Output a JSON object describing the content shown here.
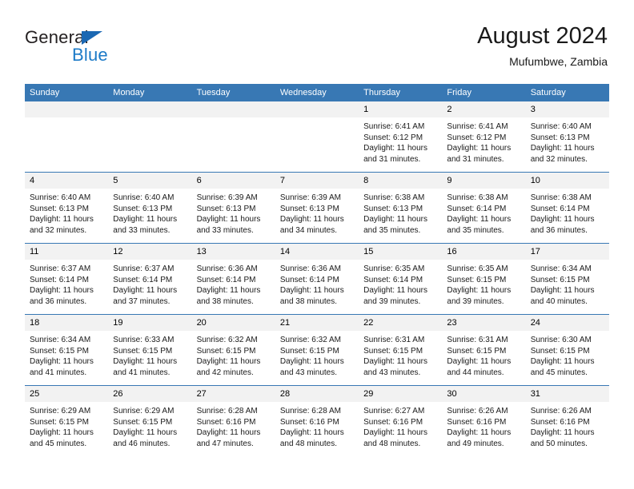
{
  "brand": {
    "name_part1": "General",
    "name_part2": "Blue",
    "accent_color": "#1c7ac7",
    "triangle_color": "#1b68b3"
  },
  "header": {
    "title": "August 2024",
    "subtitle": "Mufumbwe, Zambia",
    "header_bg": "#3878b4",
    "daynum_bg": "#f2f2f2"
  },
  "weekdays": [
    "Sunday",
    "Monday",
    "Tuesday",
    "Wednesday",
    "Thursday",
    "Friday",
    "Saturday"
  ],
  "weeks": [
    [
      {
        "day": "",
        "sunrise": "",
        "sunset": "",
        "daylight_line1": "",
        "daylight_line2": ""
      },
      {
        "day": "",
        "sunrise": "",
        "sunset": "",
        "daylight_line1": "",
        "daylight_line2": ""
      },
      {
        "day": "",
        "sunrise": "",
        "sunset": "",
        "daylight_line1": "",
        "daylight_line2": ""
      },
      {
        "day": "",
        "sunrise": "",
        "sunset": "",
        "daylight_line1": "",
        "daylight_line2": ""
      },
      {
        "day": "1",
        "sunrise": "Sunrise: 6:41 AM",
        "sunset": "Sunset: 6:12 PM",
        "daylight_line1": "Daylight: 11 hours",
        "daylight_line2": "and 31 minutes."
      },
      {
        "day": "2",
        "sunrise": "Sunrise: 6:41 AM",
        "sunset": "Sunset: 6:12 PM",
        "daylight_line1": "Daylight: 11 hours",
        "daylight_line2": "and 31 minutes."
      },
      {
        "day": "3",
        "sunrise": "Sunrise: 6:40 AM",
        "sunset": "Sunset: 6:13 PM",
        "daylight_line1": "Daylight: 11 hours",
        "daylight_line2": "and 32 minutes."
      }
    ],
    [
      {
        "day": "4",
        "sunrise": "Sunrise: 6:40 AM",
        "sunset": "Sunset: 6:13 PM",
        "daylight_line1": "Daylight: 11 hours",
        "daylight_line2": "and 32 minutes."
      },
      {
        "day": "5",
        "sunrise": "Sunrise: 6:40 AM",
        "sunset": "Sunset: 6:13 PM",
        "daylight_line1": "Daylight: 11 hours",
        "daylight_line2": "and 33 minutes."
      },
      {
        "day": "6",
        "sunrise": "Sunrise: 6:39 AM",
        "sunset": "Sunset: 6:13 PM",
        "daylight_line1": "Daylight: 11 hours",
        "daylight_line2": "and 33 minutes."
      },
      {
        "day": "7",
        "sunrise": "Sunrise: 6:39 AM",
        "sunset": "Sunset: 6:13 PM",
        "daylight_line1": "Daylight: 11 hours",
        "daylight_line2": "and 34 minutes."
      },
      {
        "day": "8",
        "sunrise": "Sunrise: 6:38 AM",
        "sunset": "Sunset: 6:13 PM",
        "daylight_line1": "Daylight: 11 hours",
        "daylight_line2": "and 35 minutes."
      },
      {
        "day": "9",
        "sunrise": "Sunrise: 6:38 AM",
        "sunset": "Sunset: 6:14 PM",
        "daylight_line1": "Daylight: 11 hours",
        "daylight_line2": "and 35 minutes."
      },
      {
        "day": "10",
        "sunrise": "Sunrise: 6:38 AM",
        "sunset": "Sunset: 6:14 PM",
        "daylight_line1": "Daylight: 11 hours",
        "daylight_line2": "and 36 minutes."
      }
    ],
    [
      {
        "day": "11",
        "sunrise": "Sunrise: 6:37 AM",
        "sunset": "Sunset: 6:14 PM",
        "daylight_line1": "Daylight: 11 hours",
        "daylight_line2": "and 36 minutes."
      },
      {
        "day": "12",
        "sunrise": "Sunrise: 6:37 AM",
        "sunset": "Sunset: 6:14 PM",
        "daylight_line1": "Daylight: 11 hours",
        "daylight_line2": "and 37 minutes."
      },
      {
        "day": "13",
        "sunrise": "Sunrise: 6:36 AM",
        "sunset": "Sunset: 6:14 PM",
        "daylight_line1": "Daylight: 11 hours",
        "daylight_line2": "and 38 minutes."
      },
      {
        "day": "14",
        "sunrise": "Sunrise: 6:36 AM",
        "sunset": "Sunset: 6:14 PM",
        "daylight_line1": "Daylight: 11 hours",
        "daylight_line2": "and 38 minutes."
      },
      {
        "day": "15",
        "sunrise": "Sunrise: 6:35 AM",
        "sunset": "Sunset: 6:14 PM",
        "daylight_line1": "Daylight: 11 hours",
        "daylight_line2": "and 39 minutes."
      },
      {
        "day": "16",
        "sunrise": "Sunrise: 6:35 AM",
        "sunset": "Sunset: 6:15 PM",
        "daylight_line1": "Daylight: 11 hours",
        "daylight_line2": "and 39 minutes."
      },
      {
        "day": "17",
        "sunrise": "Sunrise: 6:34 AM",
        "sunset": "Sunset: 6:15 PM",
        "daylight_line1": "Daylight: 11 hours",
        "daylight_line2": "and 40 minutes."
      }
    ],
    [
      {
        "day": "18",
        "sunrise": "Sunrise: 6:34 AM",
        "sunset": "Sunset: 6:15 PM",
        "daylight_line1": "Daylight: 11 hours",
        "daylight_line2": "and 41 minutes."
      },
      {
        "day": "19",
        "sunrise": "Sunrise: 6:33 AM",
        "sunset": "Sunset: 6:15 PM",
        "daylight_line1": "Daylight: 11 hours",
        "daylight_line2": "and 41 minutes."
      },
      {
        "day": "20",
        "sunrise": "Sunrise: 6:32 AM",
        "sunset": "Sunset: 6:15 PM",
        "daylight_line1": "Daylight: 11 hours",
        "daylight_line2": "and 42 minutes."
      },
      {
        "day": "21",
        "sunrise": "Sunrise: 6:32 AM",
        "sunset": "Sunset: 6:15 PM",
        "daylight_line1": "Daylight: 11 hours",
        "daylight_line2": "and 43 minutes."
      },
      {
        "day": "22",
        "sunrise": "Sunrise: 6:31 AM",
        "sunset": "Sunset: 6:15 PM",
        "daylight_line1": "Daylight: 11 hours",
        "daylight_line2": "and 43 minutes."
      },
      {
        "day": "23",
        "sunrise": "Sunrise: 6:31 AM",
        "sunset": "Sunset: 6:15 PM",
        "daylight_line1": "Daylight: 11 hours",
        "daylight_line2": "and 44 minutes."
      },
      {
        "day": "24",
        "sunrise": "Sunrise: 6:30 AM",
        "sunset": "Sunset: 6:15 PM",
        "daylight_line1": "Daylight: 11 hours",
        "daylight_line2": "and 45 minutes."
      }
    ],
    [
      {
        "day": "25",
        "sunrise": "Sunrise: 6:29 AM",
        "sunset": "Sunset: 6:15 PM",
        "daylight_line1": "Daylight: 11 hours",
        "daylight_line2": "and 45 minutes."
      },
      {
        "day": "26",
        "sunrise": "Sunrise: 6:29 AM",
        "sunset": "Sunset: 6:15 PM",
        "daylight_line1": "Daylight: 11 hours",
        "daylight_line2": "and 46 minutes."
      },
      {
        "day": "27",
        "sunrise": "Sunrise: 6:28 AM",
        "sunset": "Sunset: 6:16 PM",
        "daylight_line1": "Daylight: 11 hours",
        "daylight_line2": "and 47 minutes."
      },
      {
        "day": "28",
        "sunrise": "Sunrise: 6:28 AM",
        "sunset": "Sunset: 6:16 PM",
        "daylight_line1": "Daylight: 11 hours",
        "daylight_line2": "and 48 minutes."
      },
      {
        "day": "29",
        "sunrise": "Sunrise: 6:27 AM",
        "sunset": "Sunset: 6:16 PM",
        "daylight_line1": "Daylight: 11 hours",
        "daylight_line2": "and 48 minutes."
      },
      {
        "day": "30",
        "sunrise": "Sunrise: 6:26 AM",
        "sunset": "Sunset: 6:16 PM",
        "daylight_line1": "Daylight: 11 hours",
        "daylight_line2": "and 49 minutes."
      },
      {
        "day": "31",
        "sunrise": "Sunrise: 6:26 AM",
        "sunset": "Sunset: 6:16 PM",
        "daylight_line1": "Daylight: 11 hours",
        "daylight_line2": "and 50 minutes."
      }
    ]
  ]
}
